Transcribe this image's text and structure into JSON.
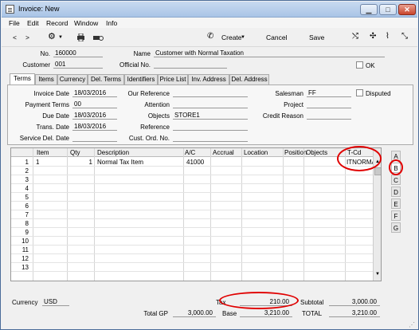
{
  "window": {
    "title": "Invoice: New"
  },
  "menu": [
    "File",
    "Edit",
    "Record",
    "Window",
    "Info"
  ],
  "toolbar": {
    "create": "Create",
    "cancel": "Cancel",
    "save": "Save"
  },
  "header": {
    "no_label": "No.",
    "no_value": "160000",
    "name_label": "Name",
    "name_value": "Customer with Normal Taxation",
    "customer_label": "Customer",
    "customer_value": "001",
    "official_label": "Official No.",
    "official_value": "",
    "ok_label": "OK"
  },
  "tabs": [
    "Terms",
    "Items",
    "Currency",
    "Del. Terms",
    "Identifiers",
    "Price List",
    "Inv. Address",
    "Del. Address"
  ],
  "terms": {
    "invoice_date_label": "Invoice Date",
    "invoice_date": "18/03/2016",
    "payment_terms_label": "Payment Terms",
    "payment_terms": "00",
    "due_date_label": "Due Date",
    "due_date": "18/03/2016",
    "trans_date_label": "Trans. Date",
    "trans_date": "18/03/2016",
    "service_del_label": "Service Del. Date",
    "service_del": "",
    "our_ref_label": "Our Reference",
    "our_ref": "",
    "attention_label": "Attention",
    "attention": "",
    "objects_label": "Objects",
    "objects": "STORE1",
    "reference_label": "Reference",
    "reference": "",
    "cust_ord_label": "Cust. Ord. No.",
    "cust_ord": "",
    "salesman_label": "Salesman",
    "salesman": "FF",
    "disputed_label": "Disputed",
    "project_label": "Project",
    "project": "",
    "credit_reason_label": "Credit Reason",
    "credit_reason": ""
  },
  "grid": {
    "columns": [
      "Item",
      "Qty",
      "Description",
      "A/C",
      "Accrual",
      "Location",
      "Position",
      "Objects",
      "T-Cd"
    ],
    "rows": [
      {
        "n": "1",
        "item": "1",
        "qty": "1",
        "desc": "Normal Tax Item",
        "ac": "41000",
        "tcd": "ITNORMAL"
      },
      {
        "n": "2"
      },
      {
        "n": "3"
      },
      {
        "n": "4"
      },
      {
        "n": "5"
      },
      {
        "n": "6"
      },
      {
        "n": "7"
      },
      {
        "n": "8"
      },
      {
        "n": "9"
      },
      {
        "n": "10"
      },
      {
        "n": "11"
      },
      {
        "n": "12"
      },
      {
        "n": "13"
      }
    ],
    "side_tabs": [
      "A",
      "B",
      "C",
      "D",
      "E",
      "F",
      "G"
    ]
  },
  "footer": {
    "currency_label": "Currency",
    "currency": "USD",
    "tax_label": "Tax",
    "tax": "210.00",
    "subtotal_label": "Subtotal",
    "subtotal": "3,000.00",
    "totalgp_label": "Total GP",
    "totalgp": "3,000.00",
    "base_label": "Base",
    "base": "3,210.00",
    "total_label": "TOTAL",
    "total": "3,210.00"
  },
  "colors": {
    "highlight_ring": "#e00000",
    "titlebar": "#a9c4e6"
  }
}
